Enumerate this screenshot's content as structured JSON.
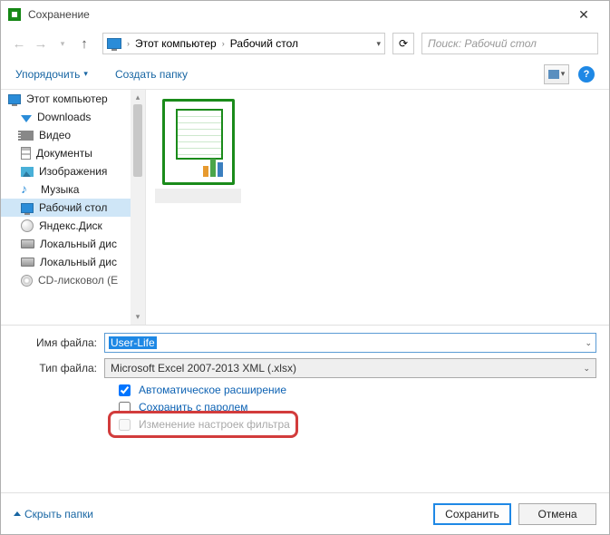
{
  "window": {
    "title": "Сохранение"
  },
  "breadcrumb": {
    "root": "Этот компьютер",
    "current": "Рабочий стол"
  },
  "search": {
    "placeholder": "Поиск: Рабочий стол"
  },
  "toolbar": {
    "organize": "Упорядочить",
    "newfolder": "Создать папку"
  },
  "sidebar": {
    "items": [
      {
        "label": "Этот компьютер"
      },
      {
        "label": "Downloads"
      },
      {
        "label": "Видео"
      },
      {
        "label": "Документы"
      },
      {
        "label": "Изображения"
      },
      {
        "label": "Музыка"
      },
      {
        "label": "Рабочий стол"
      },
      {
        "label": "Яндекс.Диск"
      },
      {
        "label": "Локальный дис"
      },
      {
        "label": "Локальный дис"
      },
      {
        "label": "CD-лисковол (E"
      }
    ]
  },
  "form": {
    "name_label": "Имя файла:",
    "name_value": "User-Life",
    "type_label": "Тип файла:",
    "type_value": "Microsoft Excel 2007-2013 XML (.xlsx)"
  },
  "checks": {
    "auto_ext": "Автоматическое расширение",
    "save_pwd": "Сохранить с паролем",
    "filter": "Изменение настроек фильтра"
  },
  "footer": {
    "hide": "Скрыть папки",
    "save": "Сохранить",
    "cancel": "Отмена"
  }
}
